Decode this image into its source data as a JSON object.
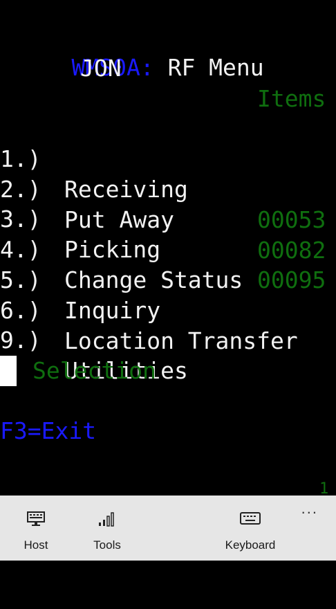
{
  "header": {
    "screen_id": "WMS0A:",
    "title": "RF Menu",
    "user": "JON"
  },
  "items_header": "Items",
  "menu": [
    {
      "num": "1.)",
      "label": "Receiving",
      "count": "00053"
    },
    {
      "num": "2.)",
      "label": "Put Away",
      "count": "00082"
    },
    {
      "num": "3.)",
      "label": "Picking",
      "count": "00095"
    },
    {
      "num": "4.)",
      "label": "Change Status",
      "count": ""
    },
    {
      "num": "5.)",
      "label": "Inquiry",
      "count": ""
    },
    {
      "num": "6.)",
      "label": "Location Transfer",
      "count": ""
    },
    {
      "num": "9.)",
      "label": "Utilities",
      "count": ""
    }
  ],
  "selection_label": "Selection",
  "function_key": "F3=Exit",
  "page_indicator": "1",
  "appbar": {
    "host_label": "Host",
    "tools_label": "Tools",
    "keyboard_label": "Keyboard",
    "more_label": "..."
  },
  "colors": {
    "background": "#000000",
    "blue_text": "#1a1aff",
    "white_text": "#f2f2f2",
    "green_text": "#0f6e0f",
    "appbar": "#e6e6e6"
  }
}
